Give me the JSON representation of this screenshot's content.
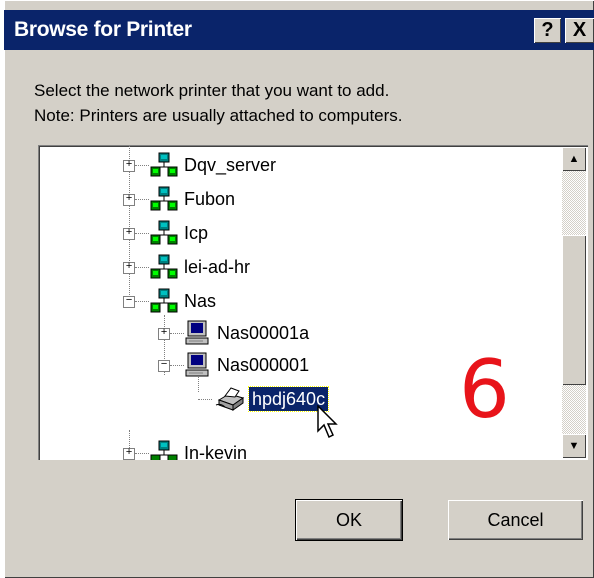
{
  "window": {
    "title": "Browse for Printer",
    "help_label": "?",
    "close_label": "X"
  },
  "instructions": {
    "line1": "Select the network printer that you want to add.",
    "line2": "Note: Printers are usually attached to computers."
  },
  "tree": {
    "nodes": [
      {
        "label": "Dqv_server",
        "expander": "+",
        "icon": "network-server-icon"
      },
      {
        "label": "Fubon",
        "expander": "+",
        "icon": "network-server-icon"
      },
      {
        "label": "Icp",
        "expander": "+",
        "icon": "network-server-icon"
      },
      {
        "label": "lei-ad-hr",
        "expander": "+",
        "icon": "network-server-icon"
      },
      {
        "label": "Nas",
        "expander": "−",
        "icon": "network-server-icon"
      },
      {
        "label": "Nas00001a",
        "expander": "+",
        "icon": "computer-icon"
      },
      {
        "label": "Nas000001",
        "expander": "−",
        "icon": "computer-icon"
      },
      {
        "label": "hpdj640c",
        "expander": "",
        "icon": "printer-icon",
        "selected": true
      },
      {
        "label": "In-kevin",
        "expander": "+",
        "icon": "network-server-icon"
      }
    ]
  },
  "scrollbar": {
    "up_arrow": "▲",
    "down_arrow": "▼"
  },
  "annotation": {
    "number": "6",
    "color": "#e8141a"
  },
  "buttons": {
    "ok_label": "OK",
    "cancel_label": "Cancel"
  },
  "colors": {
    "titlebar": "#0a246a",
    "dialog": "#d4d0c8",
    "selection": "#0a246a"
  }
}
